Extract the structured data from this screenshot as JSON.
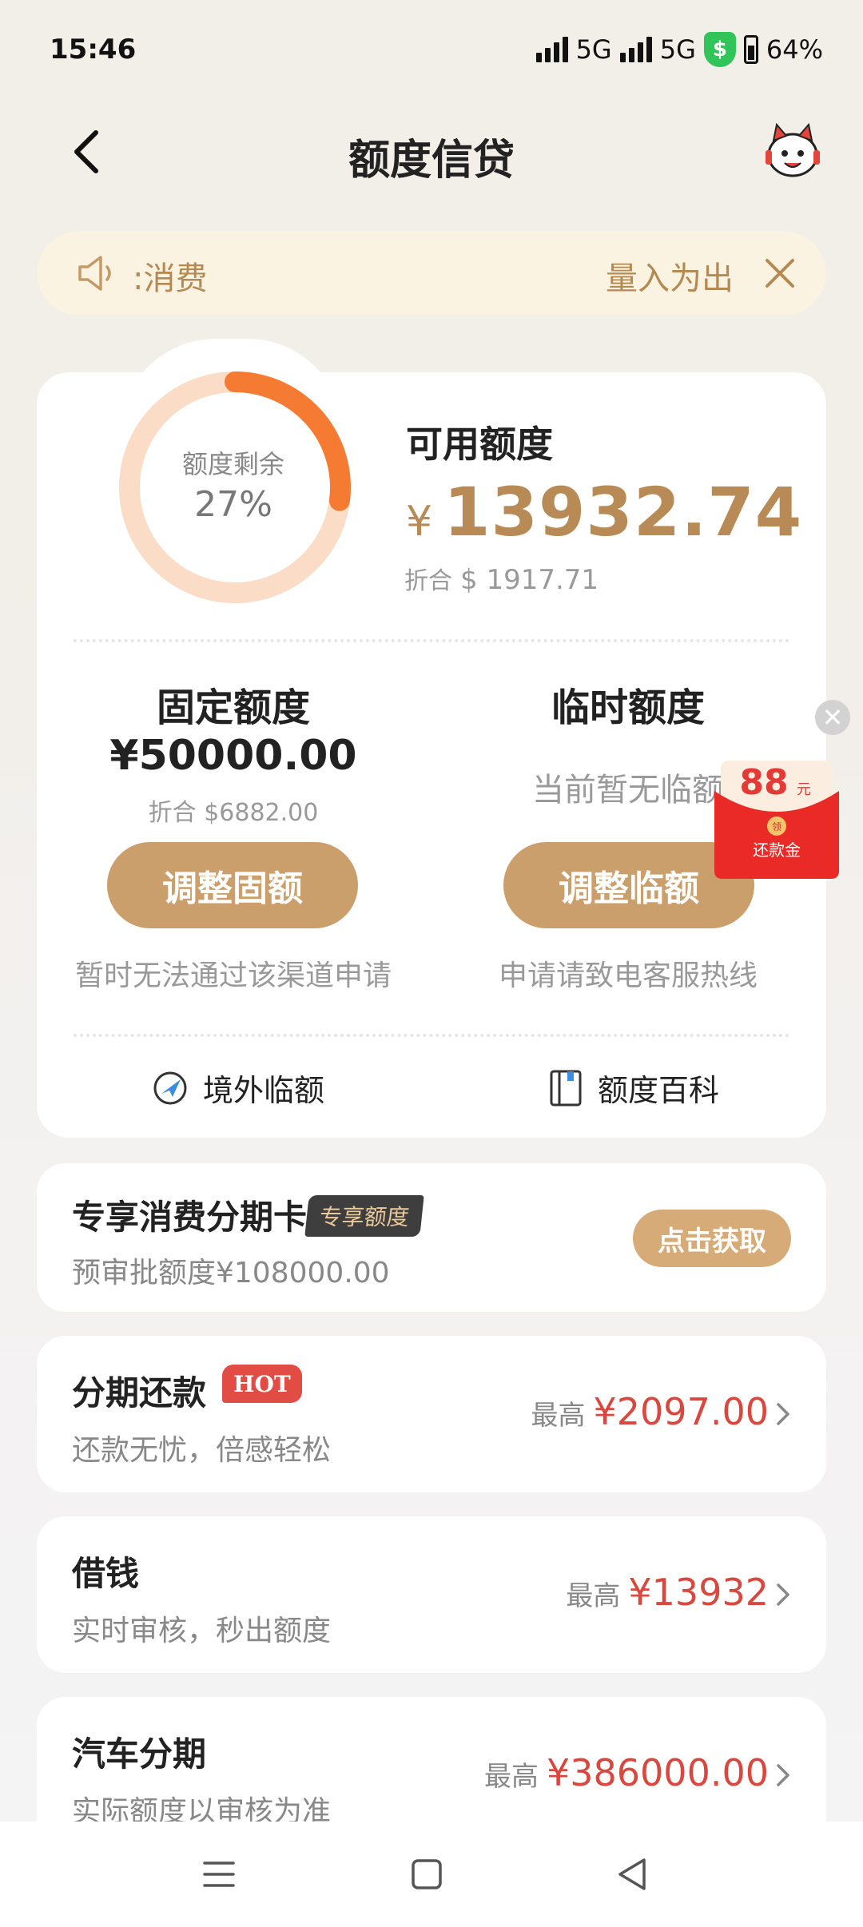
{
  "status_bar": {
    "time": "15:46",
    "net1": "5G",
    "net2": "5G",
    "vpn_icon": "$",
    "battery": "64%"
  },
  "header": {
    "title": "额度信贷"
  },
  "notice": {
    "text": ":消费",
    "slogan": "量入为出"
  },
  "quota": {
    "gauge_label": "额度剩余",
    "gauge_value": "27%",
    "gauge_remaining_fraction": 0.27,
    "available_label": "可用额度",
    "currency_symbol": "¥",
    "available_amount": "13932.74",
    "usd_prefix": "折合",
    "usd_value": "$ 1917.71"
  },
  "fixed": {
    "title": "固定额度",
    "amount": "¥50000.00",
    "usd": "折合 $6882.00",
    "button": "调整固额",
    "note": "暂时无法通过该渠道申请"
  },
  "temporary": {
    "title": "临时额度",
    "desc": "当前暂无临额",
    "button": "调整临额",
    "note": "申请请致电客服热线"
  },
  "links": {
    "overseas": "境外临额",
    "wiki": "额度百科"
  },
  "red_packet": {
    "amount": "88",
    "unit": "元",
    "seal": "领",
    "label": "还款金",
    "close": "✕"
  },
  "installment_card": {
    "title": "专享消费分期卡",
    "tag": "专享额度",
    "subtitle": "预审批额度¥108000.00",
    "button": "点击获取"
  },
  "services": [
    {
      "title": "分期还款",
      "badge": "HOT",
      "subtitle": "还款无忧，倍感轻松",
      "prefix": "最高",
      "amount": "¥2097.00"
    },
    {
      "title": "借钱",
      "subtitle": "实时审核，秒出额度",
      "prefix": "最高",
      "amount": "¥13932"
    },
    {
      "title": "汽车分期",
      "subtitle": "实际额度以审核为准",
      "prefix": "最高",
      "amount": "¥386000.00"
    }
  ],
  "colors": {
    "gold": "#b88a56",
    "accent_orange": "#f47b31",
    "price_red": "#d9473e"
  }
}
